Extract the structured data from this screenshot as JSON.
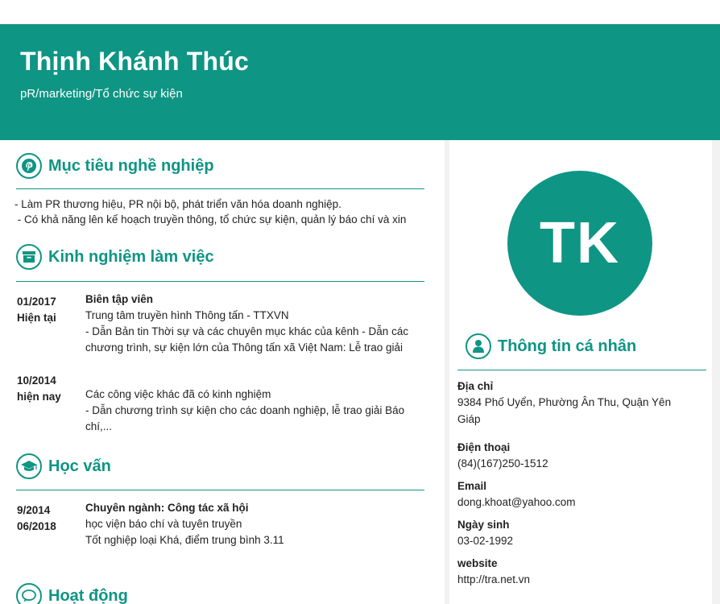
{
  "header": {
    "name": "Thịnh Khánh Thúc",
    "role": "pR/marketing/Tổ chức sự kiện"
  },
  "objective": {
    "title": "Mục tiêu nghề nghiệp",
    "lines": [
      "- Làm PR thương hiệu, PR nội bộ, phát triển văn hóa doanh nghiệp.",
      " - Có khả năng lên kế hoạch truyền thông, tổ chức sự kiện, quản lý báo chí và xin"
    ]
  },
  "experience": {
    "title": "Kinh nghiệm làm việc",
    "items": [
      {
        "start": "01/2017",
        "end": "Hiện tại",
        "position": "Biên tập viên",
        "company": "Trung tâm truyền hình Thông tấn - TTXVN",
        "desc_lines": [
          "- Dẫn Bản tin Thời sự và các chuyên mục khác của kênh - Dẫn các",
          "chương trình, sự kiện lớn của Thông tấn xã Việt Nam: Lễ trao giải"
        ]
      },
      {
        "start": "10/2014",
        "end": "hiện nay",
        "position": "",
        "company": "Các công việc khác đã có kinh nghiệm",
        "desc_lines": [
          "- Dẫn chương trình sự kiện cho các doanh nghiệp, lễ trao giải Báo",
          "chí,..."
        ]
      }
    ]
  },
  "education": {
    "title": "Học vấn",
    "items": [
      {
        "start": "9/2014",
        "end": "06/2018",
        "major": "Chuyên ngành: Công tác xã hội",
        "school": "học viện báo chí và tuyên truyền",
        "note": "Tốt nghiệp loại Khá, điểm trung bình 3.11"
      }
    ]
  },
  "activities": {
    "title": "Hoạt động"
  },
  "avatar": {
    "initials": "TK"
  },
  "personal": {
    "title": "Thông tin cá nhân",
    "address_label": "Địa chỉ",
    "address_lines": [
      "9384 Phố Uyển, Phường Ân Thu, Quận Yên",
      "Giáp"
    ],
    "phone_label": "Điện thoại",
    "phone": "(84)(167)250-1512",
    "email_label": "Email",
    "email": "dong.khoat@yahoo.com",
    "birthday_label": "Ngày sinh",
    "birthday": "03-02-1992",
    "website_label": "website",
    "website": "http://tra.net.vn"
  },
  "colors": {
    "accent": "#0e9584"
  }
}
